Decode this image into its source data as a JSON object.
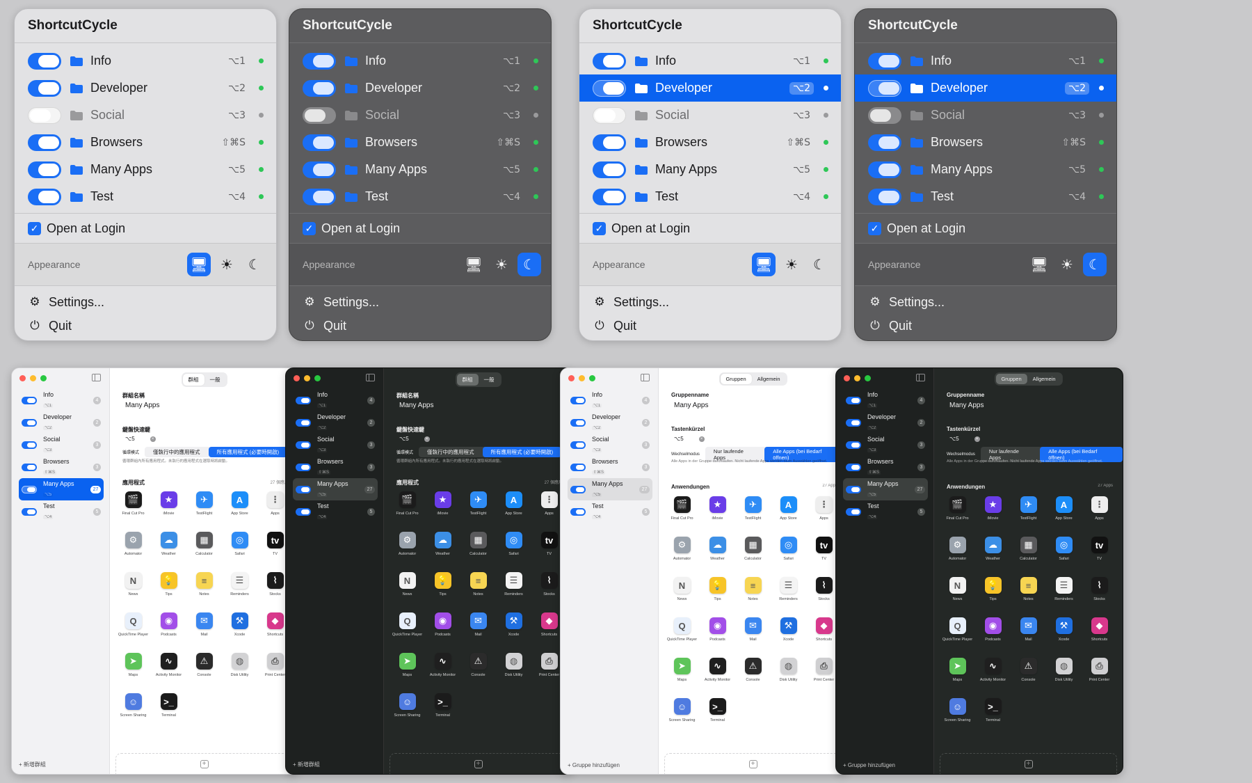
{
  "menu": {
    "title": "ShortcutCycle",
    "groups": [
      {
        "name": "Info",
        "shortcut": "⌥1",
        "enabled": true,
        "status": "green"
      },
      {
        "name": "Developer",
        "shortcut": "⌥2",
        "enabled": true,
        "status": "green"
      },
      {
        "name": "Social",
        "shortcut": "⌥3",
        "enabled": false,
        "status": "gray"
      },
      {
        "name": "Browsers",
        "shortcut": "⇧⌘S",
        "enabled": true,
        "status": "green"
      },
      {
        "name": "Many Apps",
        "shortcut": "⌥5",
        "enabled": true,
        "status": "green"
      },
      {
        "name": "Test",
        "shortcut": "⌥4",
        "enabled": true,
        "status": "green"
      }
    ],
    "open_at_login_label": "Open at Login",
    "open_at_login_checked": true,
    "appearance_label": "Appearance",
    "settings_label": "Settings...",
    "quit_label": "Quit"
  },
  "menu_variants": [
    {
      "theme": "light",
      "selected_group": -1,
      "appearance_active": "system"
    },
    {
      "theme": "dark",
      "selected_group": -1,
      "appearance_active": "dark"
    },
    {
      "theme": "light",
      "selected_group": 1,
      "appearance_active": "system"
    },
    {
      "theme": "dark",
      "selected_group": 1,
      "appearance_active": "dark"
    }
  ],
  "icons": {
    "folder": "folder-icon",
    "system": "monitor-icon",
    "light": "sun-icon",
    "dark": "moon-icon",
    "settings": "gear-icon",
    "quit": "power-icon"
  },
  "colors": {
    "accent": "#1a6ef5",
    "selection": "#0a62f0",
    "status_on": "#2ec757",
    "status_off": "#9a9a9c"
  },
  "window_groups": [
    {
      "name": "Info",
      "shortcut": "⌥1",
      "count": "4"
    },
    {
      "name": "Developer",
      "shortcut": "⌥2",
      "count": "2"
    },
    {
      "name": "Social",
      "shortcut": "⌥3",
      "count": "3"
    },
    {
      "name": "Browsers",
      "shortcut": "⇧⌘S",
      "count": "3"
    },
    {
      "name": "Many Apps",
      "shortcut": "⌥5",
      "count": "27"
    },
    {
      "name": "Test",
      "shortcut": "⌥4",
      "count": "5"
    }
  ],
  "window_selected_group": 4,
  "locales": {
    "zh": {
      "tab_groups": "群組",
      "tab_general": "一般",
      "group_name_label": "群組名稱",
      "group_name_value": "Many Apps",
      "shortcut_label": "鍵盤快速鍵",
      "shortcut_value": "⌥5",
      "mode_label": "循環模式",
      "mode_option_running": "僅執行中的應用程式",
      "mode_option_all": "所有應用程式 (必要時開啟)",
      "mode_desc": "循環群組內所有應用程式。未執行的應用程式在選取時將啟動。",
      "apps_label": "應用程式",
      "apps_count": "27 個應用",
      "add_group": "新增群組"
    },
    "de": {
      "tab_groups": "Gruppen",
      "tab_general": "Allgemein",
      "group_name_label": "Gruppenname",
      "group_name_value": "Many Apps",
      "shortcut_label": "Tastenkürzel",
      "shortcut_value": "⌥5",
      "mode_label": "Wechselmodus",
      "mode_option_running": "Nur laufende Apps",
      "mode_option_all": "Alle Apps (bei Bedarf öffnen)",
      "mode_desc": "Alle Apps in der Gruppe durchlaufen. Nicht laufende Apps werden beim Auswählen geöffnet.",
      "apps_label": "Anwendungen",
      "apps_count": "27 Apps",
      "add_group": "Gruppe hinzufügen"
    }
  },
  "window_variants": [
    {
      "theme": "light",
      "locale": "zh",
      "selection_style": "blue"
    },
    {
      "theme": "dark",
      "locale": "zh",
      "selection_style": "gray"
    },
    {
      "theme": "light",
      "locale": "de",
      "selection_style": "gray"
    },
    {
      "theme": "dark",
      "locale": "de",
      "selection_style": "gray"
    }
  ],
  "apps": [
    {
      "name": "Final Cut Pro",
      "icon": "clapper-icon",
      "color": "#1b1b1b",
      "glyph": "🎬"
    },
    {
      "name": "iMovie",
      "icon": "star-icon",
      "color": "#6a3de8",
      "glyph": "★"
    },
    {
      "name": "TestFlight",
      "icon": "propeller-icon",
      "color": "#2f8cf5",
      "glyph": "✈"
    },
    {
      "name": "App Store",
      "icon": "app-store-icon",
      "color": "#1c8ef9",
      "glyph": "A"
    },
    {
      "name": "Apps",
      "icon": "grid-icon",
      "color": "#eeeeee",
      "glyph": "⋮"
    },
    {
      "name": "Automator",
      "icon": "robot-icon",
      "color": "#9aa3ad",
      "glyph": "⚙"
    },
    {
      "name": "Weather",
      "icon": "cloud-sun-icon",
      "color": "#3c8fe6",
      "glyph": "☁"
    },
    {
      "name": "Calculator",
      "icon": "calculator-icon",
      "color": "#5a5a5c",
      "glyph": "▦"
    },
    {
      "name": "Safari",
      "icon": "compass-icon",
      "color": "#2f8cf5",
      "glyph": "◎"
    },
    {
      "name": "TV",
      "icon": "tv-icon",
      "color": "#111111",
      "glyph": "tv"
    },
    {
      "name": "News",
      "icon": "news-icon",
      "color": "#f2f2f2",
      "glyph": "N"
    },
    {
      "name": "Tips",
      "icon": "lightbulb-icon",
      "color": "#f7c428",
      "glyph": "💡"
    },
    {
      "name": "Notes",
      "icon": "notes-icon",
      "color": "#f7d552",
      "glyph": "≡"
    },
    {
      "name": "Reminders",
      "icon": "list-icon",
      "color": "#f4f4f4",
      "glyph": "☰"
    },
    {
      "name": "Stocks",
      "icon": "chart-icon",
      "color": "#1b1b1b",
      "glyph": "⌇"
    },
    {
      "name": "QuickTime Player",
      "icon": "quicktime-icon",
      "color": "#e8f0fb",
      "glyph": "Q"
    },
    {
      "name": "Podcasts",
      "icon": "podcast-icon",
      "color": "#a24ee8",
      "glyph": "◉"
    },
    {
      "name": "Mail",
      "icon": "envelope-icon",
      "color": "#3a86f0",
      "glyph": "✉"
    },
    {
      "name": "Xcode",
      "icon": "hammer-icon",
      "color": "#1f6fe0",
      "glyph": "⚒"
    },
    {
      "name": "Shortcuts",
      "icon": "shortcuts-icon",
      "color": "#d8388c",
      "glyph": "◆"
    },
    {
      "name": "Maps",
      "icon": "map-icon",
      "color": "#5ec45a",
      "glyph": "➤"
    },
    {
      "name": "Activity Monitor",
      "icon": "pulse-icon",
      "color": "#1f1f1f",
      "glyph": "∿"
    },
    {
      "name": "Console",
      "icon": "console-icon",
      "color": "#2b2b2b",
      "glyph": "⚠"
    },
    {
      "name": "Disk Utility",
      "icon": "disk-icon",
      "color": "#d2d2d4",
      "glyph": "◍"
    },
    {
      "name": "Print Center",
      "icon": "printer-icon",
      "color": "#cfcfd1",
      "glyph": "⎙"
    },
    {
      "name": "Screen Sharing",
      "icon": "screen-share-icon",
      "color": "#4f7be0",
      "glyph": "☺"
    },
    {
      "name": "Terminal",
      "icon": "terminal-icon",
      "color": "#1b1b1b",
      "glyph": ">_"
    }
  ]
}
